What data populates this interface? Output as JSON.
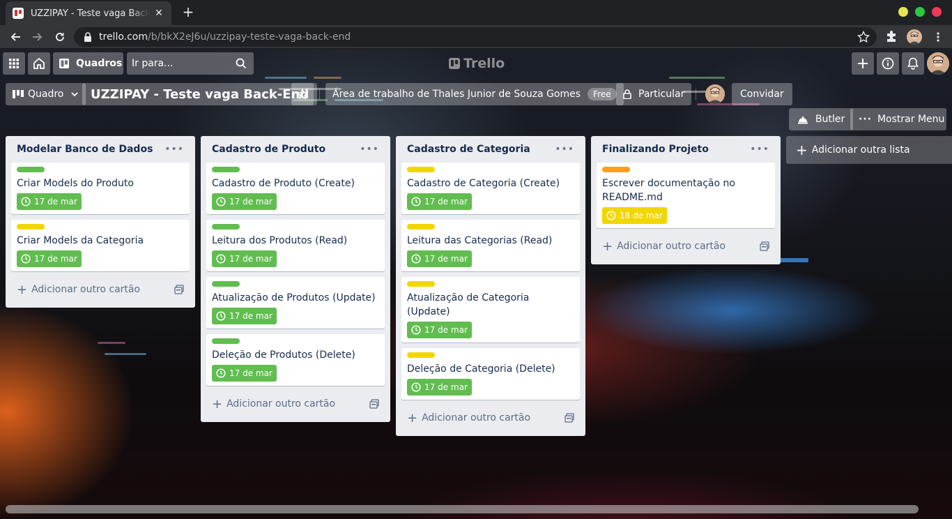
{
  "browser": {
    "tab_title": "UZZIPAY - Teste vaga Back-End | Trello",
    "url_host": "trello.com",
    "url_path": "/b/bkX2eJ6u/uzzipay-teste-vaga-back-end",
    "window_colors": [
      "#e5e552",
      "#2bc840",
      "#ee3a5a"
    ]
  },
  "header": {
    "boards_label": "Quadros",
    "search_placeholder": "Ir para...",
    "logo_text": "Trello"
  },
  "board": {
    "view_label": "Quadro",
    "name": "UZZIPAY - Teste vaga Back-End",
    "workspace": "Área de trabalho de Thales Junior de Souza Gomes",
    "workspace_badge": "Free",
    "visibility": "Particular",
    "invite_label": "Convidar",
    "butler_label": "Butler",
    "menu_label": "Mostrar Menu",
    "add_list_label": "Adicionar outra lista",
    "add_card_label": "Adicionar outro cartão"
  },
  "colors": {
    "green": "#61bd4f",
    "yellow": "#f2d600",
    "orange": "#ff9f1a",
    "due_green": "#61bd4f",
    "due_yellow": "#f2d600"
  },
  "lists": [
    {
      "title": "Modelar Banco de Dados",
      "cards": [
        {
          "label": "green",
          "title": "Criar Models do Produto",
          "due": "17 de mar",
          "due_state": "complete"
        },
        {
          "label": "yellow",
          "title": "Criar Models da Categoria",
          "due": "17 de mar",
          "due_state": "complete"
        }
      ]
    },
    {
      "title": "Cadastro de Produto",
      "cards": [
        {
          "label": "green",
          "title": "Cadastro de Produto (Create)",
          "due": "17 de mar",
          "due_state": "complete"
        },
        {
          "label": "green",
          "title": "Leitura dos Produtos (Read)",
          "due": "17 de mar",
          "due_state": "complete"
        },
        {
          "label": "green",
          "title": "Atualização de Produtos (Update)",
          "due": "17 de mar",
          "due_state": "complete"
        },
        {
          "label": "green",
          "title": "Deleção de Produtos (Delete)",
          "due": "17 de mar",
          "due_state": "complete"
        }
      ]
    },
    {
      "title": "Cadastro de Categoria",
      "cards": [
        {
          "label": "yellow",
          "title": "Cadastro de Categoria (Create)",
          "due": "17 de mar",
          "due_state": "complete"
        },
        {
          "label": "yellow",
          "title": "Leitura das Categorias (Read)",
          "due": "17 de mar",
          "due_state": "complete"
        },
        {
          "label": "yellow",
          "title": "Atualização de Categoria (Update)",
          "due": "17 de mar",
          "due_state": "complete"
        },
        {
          "label": "yellow",
          "title": "Deleção de Categoria (Delete)",
          "due": "17 de mar",
          "due_state": "complete"
        }
      ]
    },
    {
      "title": "Finalizando Projeto",
      "cards": [
        {
          "label": "orange",
          "title": "Escrever documentação no README.md",
          "due": "18 de mar",
          "due_state": "soon"
        }
      ]
    }
  ]
}
